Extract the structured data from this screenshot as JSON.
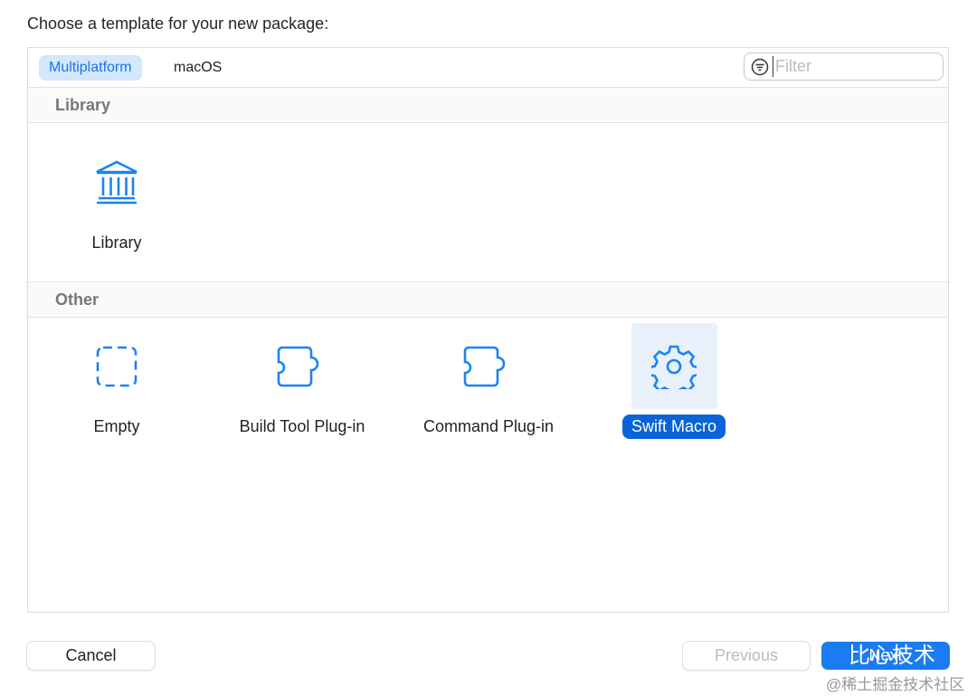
{
  "title": "Choose a template for your new package:",
  "tabs": [
    {
      "label": "Multiplatform",
      "selected": true
    },
    {
      "label": "macOS",
      "selected": false
    }
  ],
  "filter": {
    "placeholder": "Filter",
    "value": ""
  },
  "sections": [
    {
      "title": "Library",
      "items": [
        {
          "label": "Library",
          "icon": "building-columns-icon"
        }
      ]
    },
    {
      "title": "Other",
      "items": [
        {
          "label": "Empty",
          "icon": "dashed-square-icon"
        },
        {
          "label": "Build Tool Plug-in",
          "icon": "puzzle-piece-icon"
        },
        {
          "label": "Command Plug-in",
          "icon": "puzzle-piece-icon"
        },
        {
          "label": "Swift Macro",
          "icon": "gear-icon",
          "selected": true
        }
      ]
    }
  ],
  "buttons": {
    "cancel": "Cancel",
    "previous": "Previous",
    "next": "Next"
  },
  "watermark": {
    "account": "比心技术",
    "site": "@稀土掘金技术社区"
  },
  "colors": {
    "accent": "#0a64d8",
    "icon": "#1a84f0"
  }
}
